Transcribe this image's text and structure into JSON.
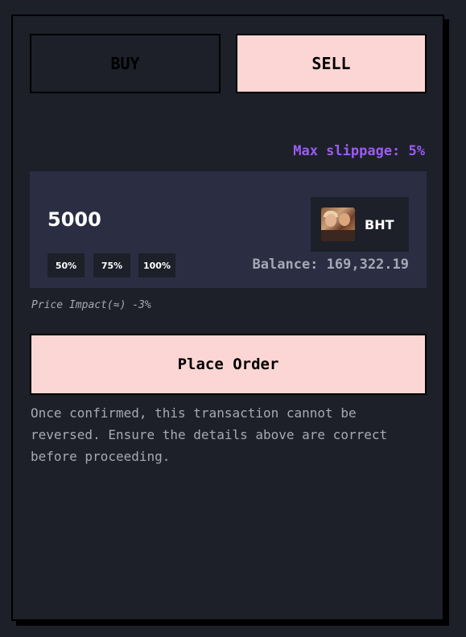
{
  "tabs": {
    "buy_label": "BUY",
    "sell_label": "SELL"
  },
  "slippage": {
    "label": "Max slippage: 5%"
  },
  "order_input": {
    "amount": "5000",
    "percent_buttons": [
      "50%",
      "75%",
      "100%"
    ],
    "token_symbol": "BHT",
    "balance": "Balance: 169,322.19"
  },
  "price_impact": "Price Impact(≈) -3%",
  "place_order_label": "Place Order",
  "disclaimer": "Once confirmed, this transaction cannot be reversed. Ensure the details above are correct before proceeding.",
  "colors": {
    "background": "#1d2029",
    "input_panel": "#2b2d42",
    "accent_pink": "#fcd6d4",
    "slippage_purple": "#9b5cf6",
    "muted_text": "#a7a8b4"
  },
  "icons": {
    "token_avatar": "token-avatar-image"
  }
}
